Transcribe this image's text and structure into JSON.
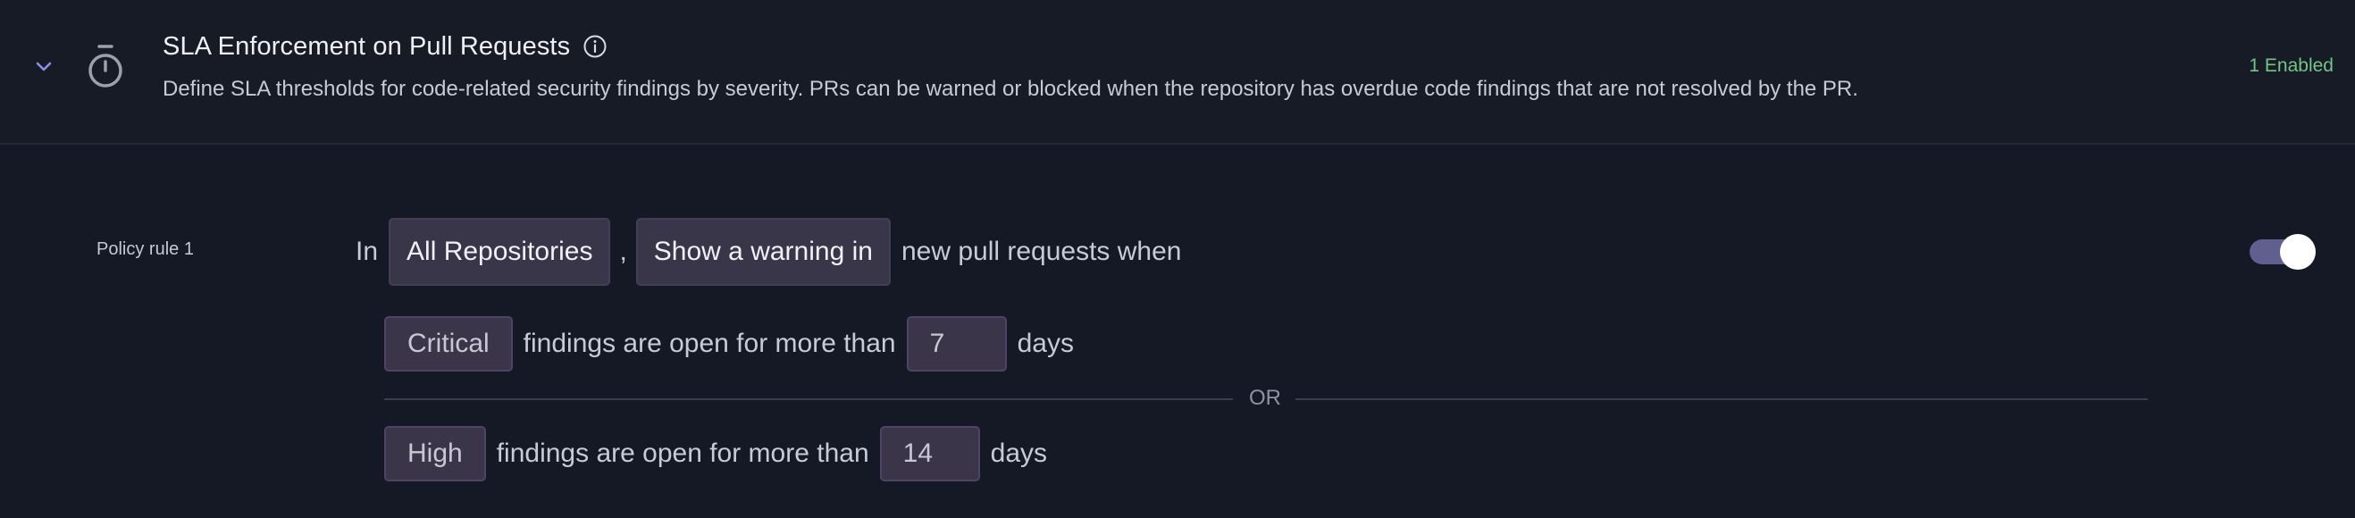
{
  "header": {
    "title": "SLA Enforcement on Pull Requests",
    "description": "Define SLA thresholds for code-related security findings by severity. PRs can be warned or blocked when the repository has overdue code findings that are not resolved by the PR.",
    "enabled_badge": "1 Enabled",
    "icons": [
      "chevron-down-icon",
      "timer-icon",
      "info-icon"
    ]
  },
  "rule": {
    "label": "Policy rule 1",
    "prefix": "In",
    "scope": "All Repositories",
    "comma": ",",
    "action": "Show a warning in",
    "suffix": "new pull requests when",
    "enabled": true,
    "conditions": [
      {
        "severity": "Critical",
        "text": "findings are open for more than",
        "days_value": "7",
        "unit": "days"
      },
      {
        "severity": "High",
        "text": "findings are open for more than",
        "days_value": "14",
        "unit": "days"
      }
    ],
    "separator": "OR"
  },
  "colors": {
    "background": "#151926",
    "header_background": "#171b26",
    "chip": "#393649",
    "enabled_green": "#74c487",
    "toggle_track": "#605f8f"
  }
}
